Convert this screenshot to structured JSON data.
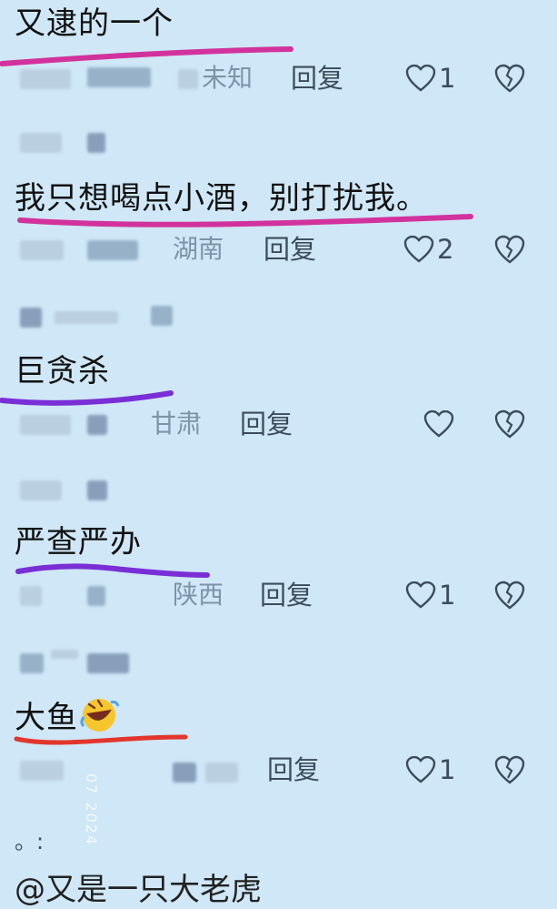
{
  "comments": [
    {
      "text": "又逮的一个",
      "region": "未知",
      "reply": "回复",
      "likes": "1",
      "stroke_color": "#d2329c"
    },
    {
      "text": "我只想喝点小酒，别打扰我。",
      "region": "湖南",
      "reply": "回复",
      "likes": "2",
      "stroke_color": "#d2329c"
    },
    {
      "text": "巨贪杀",
      "region": "甘肃",
      "reply": "回复",
      "likes": "",
      "stroke_color": "#7a2fd6"
    },
    {
      "text": "严查严办",
      "region": "陕西",
      "reply": "回复",
      "likes": "1",
      "stroke_color": "#7a2fd6"
    },
    {
      "text": "大鱼",
      "region": "",
      "reply": "回复",
      "likes": "1",
      "stroke_color": "#e2362c",
      "emoji": "rolling-on-floor-laughing-emoji"
    }
  ],
  "footer": {
    "dots": "。:",
    "text": "@又是一只大老虎"
  },
  "watermark": "07 2024"
}
